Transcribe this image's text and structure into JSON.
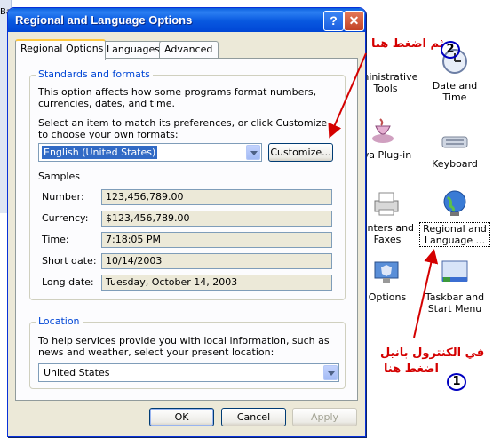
{
  "background": {
    "partial_label": "Ba",
    "control_panel_items": [
      {
        "label": "dministrative Tools"
      },
      {
        "label": "Date and Time"
      },
      {
        "label": "va Plug-in"
      },
      {
        "label": "Keyboard"
      },
      {
        "label": "rinters and Faxes"
      },
      {
        "label": "Regional and Language ..."
      },
      {
        "label": "Options"
      },
      {
        "label": "Taskbar and Start Menu"
      }
    ]
  },
  "dialog": {
    "title": "Regional and Language Options",
    "help_glyph": "?",
    "close_glyph": "✕",
    "tabs": [
      {
        "label": "Regional Options"
      },
      {
        "label": "Languages"
      },
      {
        "label": "Advanced"
      }
    ],
    "standards": {
      "group_title": "Standards and formats",
      "description": "This option affects how some programs format numbers, currencies, dates, and time.",
      "select_prompt": "Select an item to match its preferences, or click Customize to choose your own formats:",
      "format_value": "English (United States)",
      "customize_label": "Customize...",
      "samples_title": "Samples",
      "samples": [
        {
          "label": "Number:",
          "value": "123,456,789.00"
        },
        {
          "label": "Currency:",
          "value": "$123,456,789.00"
        },
        {
          "label": "Time:",
          "value": "7:18:05 PM"
        },
        {
          "label": "Short date:",
          "value": "10/14/2003"
        },
        {
          "label": "Long date:",
          "value": "Tuesday, October 14, 2003"
        }
      ]
    },
    "location": {
      "group_title": "Location",
      "description": "To help services provide you with local information, such as news and weather, select your present location:",
      "value": "United States"
    },
    "buttons": {
      "ok": "OK",
      "cancel": "Cancel",
      "apply": "Apply"
    }
  },
  "annotations": {
    "step1_text_line1": "في الكنترول بانيل",
    "step1_text_line2": "اضغط هنا",
    "step1_number": "1",
    "step2_text": "ثم اضغط هنا",
    "step2_number": "2",
    "color": "#d40000"
  }
}
